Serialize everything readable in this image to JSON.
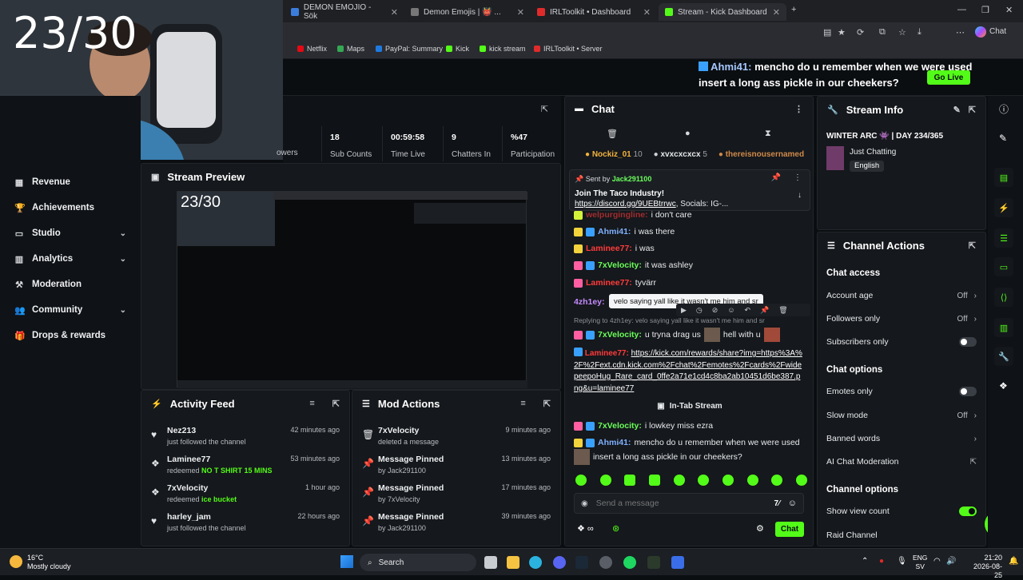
{
  "browser": {
    "tabs": [
      {
        "label": "DEMON EMOJIO - Sök",
        "active": false
      },
      {
        "label": "Demon Emojis | 👹 ... ",
        "active": false
      },
      {
        "label": "IRLToolkit • Dashboard",
        "active": false
      },
      {
        "label": "Stream - Kick Dashboard",
        "active": true
      }
    ],
    "profile_label": "Chat",
    "bookmarks": [
      "Netflix",
      "Maps",
      "PayPal: Summary",
      "Kick",
      "kick stream",
      "IRLToolkit • Server"
    ]
  },
  "overlay": {
    "counter": "23/30",
    "alert_user": "Ahmi41:",
    "alert_text_1": "mencho do u remember when we were used",
    "alert_text_2": "insert a long ass pickle in our cheekers?",
    "go_live_label": "Go Live"
  },
  "sidebar": {
    "items": [
      {
        "label": "Revenue",
        "icon": "dollar-icon",
        "chevron": false
      },
      {
        "label": "Achievements",
        "icon": "trophy-icon",
        "chevron": false
      },
      {
        "label": "Studio",
        "icon": "monitor-icon",
        "chevron": true
      },
      {
        "label": "Analytics",
        "icon": "chart-icon",
        "chevron": true
      },
      {
        "label": "Moderation",
        "icon": "hammer-icon",
        "chevron": false
      },
      {
        "label": "Community",
        "icon": "users-icon",
        "chevron": true
      },
      {
        "label": "Drops & rewards",
        "icon": "gift-icon",
        "chevron": false
      }
    ]
  },
  "stats": {
    "followers_label": "owers",
    "sub_counts": {
      "value": "18",
      "label": "Sub Counts"
    },
    "time_live": {
      "value": "00:59:58",
      "label": "Time Live"
    },
    "chatters": {
      "value": "9",
      "label": "Chatters In"
    },
    "participation": {
      "value": "%47",
      "label": "Participation"
    }
  },
  "preview": {
    "title": "Stream Preview",
    "counter": "23/30"
  },
  "activity": {
    "title": "Activity Feed",
    "items": [
      {
        "name": "Nez213",
        "sub": "just followed the channel",
        "highlight": "",
        "time": "42 minutes ago",
        "icon": "heart-icon"
      },
      {
        "name": "Laminee77",
        "sub": "redeemed",
        "highlight": "NO T SHIRT 15 MINS",
        "time": "53 minutes ago",
        "icon": "points-icon"
      },
      {
        "name": "7xVelocity",
        "sub": "redeemed",
        "highlight": "ice bucket",
        "time": "1 hour ago",
        "icon": "points-icon"
      },
      {
        "name": "harley_jam",
        "sub": "just followed the channel",
        "highlight": "",
        "time": "22 hours ago",
        "icon": "heart-icon"
      }
    ]
  },
  "mod_actions": {
    "title": "Mod Actions",
    "items": [
      {
        "name": "7xVelocity",
        "sub": "deleted a message",
        "time": "9 minutes ago",
        "icon": "trash-icon"
      },
      {
        "name": "Message Pinned",
        "sub": "by Jack291100",
        "time": "13 minutes ago",
        "icon": "pin-icon"
      },
      {
        "name": "Message Pinned",
        "sub": "by 7xVelocity",
        "time": "17 minutes ago",
        "icon": "pin-icon"
      },
      {
        "name": "Message Pinned",
        "sub": "by Jack291100",
        "time": "39 minutes ago",
        "icon": "pin-icon"
      }
    ]
  },
  "chat": {
    "title": "Chat",
    "top_users": [
      {
        "name": "Nockiz_01",
        "count": "10"
      },
      {
        "name": "xvxcxcxcx",
        "count": "5"
      },
      {
        "name": "thereisnousernamed",
        "count": ""
      }
    ],
    "pinned": {
      "sent_by_label": "Sent by",
      "sender": "Jack291100",
      "text": "Join The Taco Industry!",
      "link": "https://discord.gg/9UEBtrrwc",
      "socials": ", Socials: IG-..."
    },
    "messages": [
      {
        "user": "Ahmi41:",
        "text": "i was there",
        "color": "blue"
      },
      {
        "user": "Laminee77:",
        "text": "i was",
        "color": "red"
      },
      {
        "user": "7xVelocity:",
        "text": "it was ashley",
        "color": "green"
      },
      {
        "user": "Laminee77:",
        "text": "tyvärr",
        "color": "red"
      }
    ],
    "partial_top": "i don't care",
    "tooltip_user": "4zh1ey:",
    "tooltip": "velo saying yall like it wasn't me him and sr",
    "reply_to": "Replying to 4zh1ey: velo saying yall like it wasn't me him and sr",
    "reply_user": "7xVelocity:",
    "reply_text_a": "u tryna drag us",
    "reply_text_b": "hell with u",
    "link_user": "Laminee77:",
    "link_text": "https://kick.com/rewards/share?img=https%3A%2F%2Fext.cdn.kick.com%2Fchat%2Femotes%2Fcards%2FwidepeepoHug_Rare_card_0ffe2a71e1cd4c8ba2ab10451d6be387.png&u=laminee77",
    "divider": "In-Tab Stream",
    "m2_user": "7xVelocity:",
    "m2_text": "i lowkey miss ezra",
    "m3_user": "Ahmi41:",
    "m3_text_1": "mencho do u remember when we were used",
    "m3_text_2": "insert a long ass pickle in our cheekers?",
    "input_placeholder": "Send a message",
    "send_label": "Chat"
  },
  "stream_info": {
    "title": "Stream Info",
    "stream_title": "WINTER ARC 👾 | DAY 234/365",
    "category": "Just Chatting",
    "language": "English"
  },
  "channel_actions": {
    "title": "Channel Actions",
    "chat_access": "Chat access",
    "account_age": {
      "label": "Account age",
      "value": "Off"
    },
    "followers_only": {
      "label": "Followers only",
      "value": "Off"
    },
    "subscribers_only": {
      "label": "Subscribers only",
      "on": false
    },
    "chat_options": "Chat options",
    "emotes_only": {
      "label": "Emotes only",
      "on": false
    },
    "slow_mode": {
      "label": "Slow mode",
      "value": "Off"
    },
    "banned_words": {
      "label": "Banned words"
    },
    "ai_moderation": {
      "label": "AI Chat Moderation"
    },
    "channel_options": "Channel options",
    "show_view_count": {
      "label": "Show view count",
      "on": true
    },
    "raid_channel": {
      "label": "Raid Channel"
    }
  },
  "taskbar": {
    "weather_temp": "16°C",
    "weather_desc": "Mostly cloudy",
    "search_label": "Search",
    "lang_1": "ENG",
    "lang_2": "SV",
    "time": "21:20",
    "date": "2026-08-25"
  },
  "colors": {
    "accent": "#53fc18",
    "bg": "#0b0e11",
    "panel": "#15181c"
  }
}
